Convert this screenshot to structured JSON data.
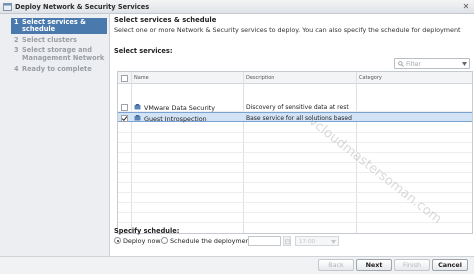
{
  "window": {
    "title": "Deploy Network & Security Services",
    "close_glyph": "✕"
  },
  "sidebar": {
    "steps": [
      {
        "num": "1",
        "label": "Select services & schedule",
        "active": true
      },
      {
        "num": "2",
        "label": "Select clusters",
        "active": false
      },
      {
        "num": "3",
        "label": "Select storage and Management Network",
        "active": false
      },
      {
        "num": "4",
        "label": "Ready to complete",
        "active": false
      }
    ]
  },
  "main": {
    "heading": "Select services & schedule",
    "subheading": "Select one or more Network & Security services to deploy. You can also specify the schedule for deployment",
    "services_label": "Select services:",
    "filter_placeholder": "Filter",
    "columns": [
      "Name",
      "Description",
      "Category"
    ],
    "rows": [
      {
        "name": "VMware Data Security",
        "description": "Discovery of sensitive data at rest",
        "category": "",
        "checked": false,
        "selected": false
      },
      {
        "name": "Guest Introspection",
        "description": "Base service for all solutions based ...",
        "category": "",
        "checked": true,
        "selected": true
      }
    ],
    "schedule_label": "Specify schedule:",
    "deploy_now_label": "Deploy now",
    "schedule_deployment_label": "Schedule the deployment",
    "time_value": "17:00",
    "watermark": "vcloudmastersoman.com"
  },
  "footer": {
    "back_label": "Back",
    "next_label": "Next",
    "finish_label": "Finish",
    "cancel_label": "Cancel"
  },
  "colors": {
    "accent": "#4a79ad",
    "selected_row": "#d3e3f6"
  }
}
